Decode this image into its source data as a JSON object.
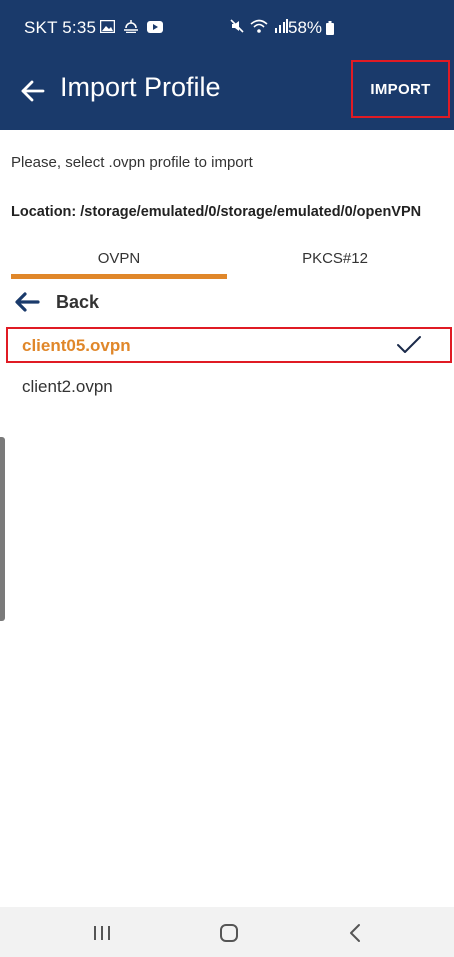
{
  "status_bar": {
    "carrier_time": "SKT 5:35",
    "battery": "58%",
    "icons_left": [
      "gallery-icon",
      "weather-icon",
      "youtube-icon"
    ],
    "icons_right": [
      "mute-icon",
      "wifi-icon",
      "signal-icon",
      "battery-icon"
    ]
  },
  "app_bar": {
    "title": "Import Profile",
    "import_label": "IMPORT"
  },
  "content": {
    "prompt": "Please, select .ovpn profile to import",
    "location": "Location: /storage/emulated/0/storage/emulated/0/openVPN"
  },
  "tabs": {
    "items": [
      {
        "label": "OVPN",
        "selected": true
      },
      {
        "label": "PKCS#12",
        "selected": false
      }
    ]
  },
  "file_list": {
    "back_label": "Back",
    "files": [
      {
        "name": "client05.ovpn",
        "selected": true
      },
      {
        "name": "client2.ovpn",
        "selected": false
      }
    ]
  },
  "colors": {
    "app_bar": "#1a3a6b",
    "accent": "#e0872a",
    "highlight_border": "#e01b24"
  }
}
